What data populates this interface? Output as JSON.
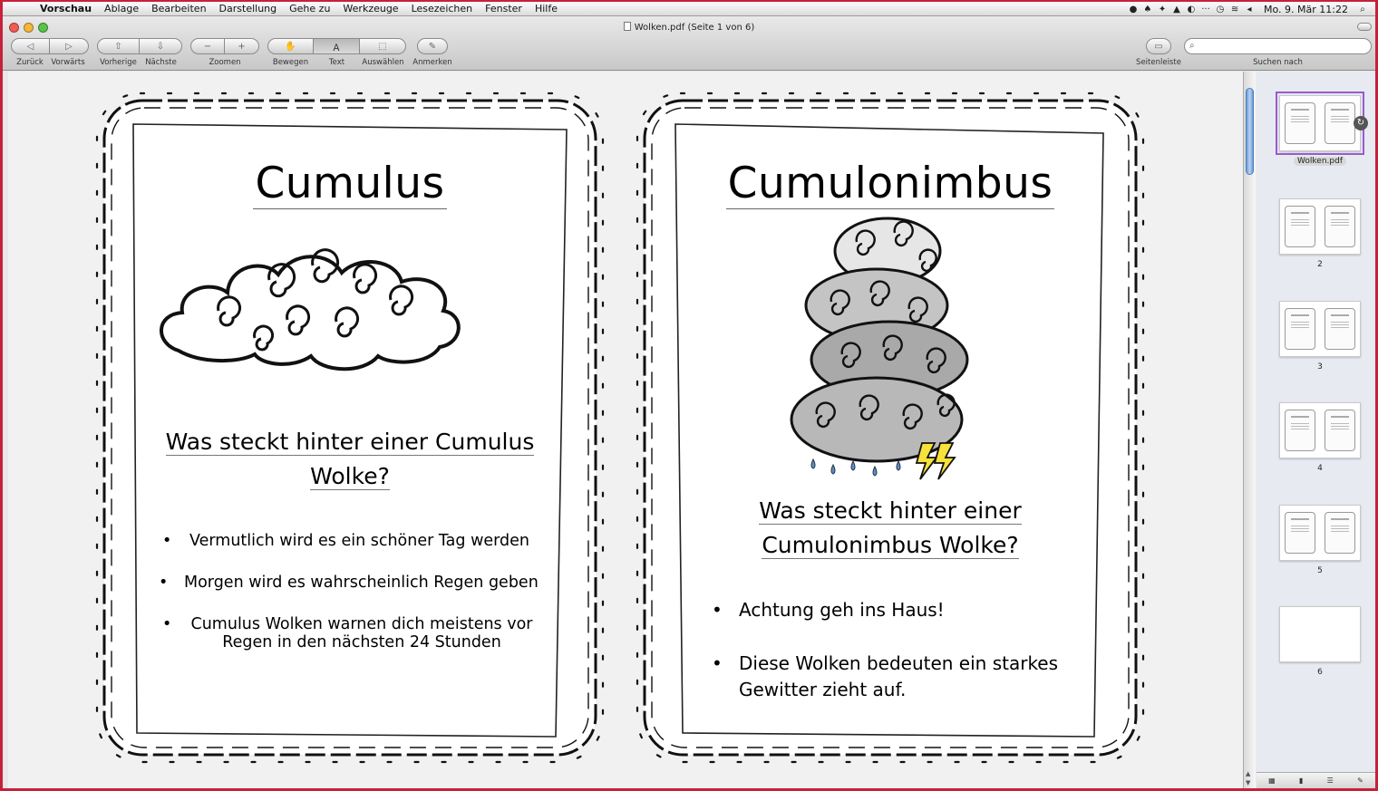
{
  "menubar": {
    "app": "Vorschau",
    "items": [
      "Ablage",
      "Bearbeiten",
      "Darstellung",
      "Gehe zu",
      "Werkzeuge",
      "Lesezeichen",
      "Fenster",
      "Hilfe"
    ],
    "tray": [
      "···"
    ],
    "clock": "Mo. 9. Mär  11:22"
  },
  "window": {
    "title": "Wolken.pdf (Seite 1 von 6)"
  },
  "toolbar": {
    "back": "Zurück",
    "forward": "Vorwärts",
    "previous": "Vorherige",
    "next": "Nächste",
    "zoom": "Zoomen",
    "move": "Bewegen",
    "text": "Text",
    "select": "Auswählen",
    "annotate": "Anmerken",
    "sidebar": "Seitenleiste",
    "search_label": "Suchen nach",
    "search_placeholder": ""
  },
  "cards": {
    "left": {
      "title": "Cumulus",
      "question_line1": "Was steckt hinter einer Cumulus",
      "question_line2": "Wolke?",
      "bullet1": "Vermutlich wird es ein schöner Tag werden",
      "bullet2": "Morgen wird es wahrscheinlich Regen geben",
      "bullet3a": "Cumulus Wolken warnen dich meistens vor",
      "bullet3b": "Regen in den nächsten 24 Stunden"
    },
    "right": {
      "title": "Cumulonimbus",
      "question_line1": "Was steckt hinter einer",
      "question_line2": "Cumulonimbus Wolke?",
      "bullet1": "Achtung geh ins Haus!",
      "bullet2a": "Diese Wolken bedeuten ein starkes",
      "bullet2b": "Gewitter zieht auf."
    }
  },
  "sidebar": {
    "file_label": "Wolken.pdf",
    "pages": [
      "2",
      "3",
      "4",
      "5",
      "6"
    ]
  },
  "colors": {
    "desktop_frame": "#c7213a",
    "selection": "#9b5ad1",
    "scroll_thumb": "#6a9ad8"
  }
}
